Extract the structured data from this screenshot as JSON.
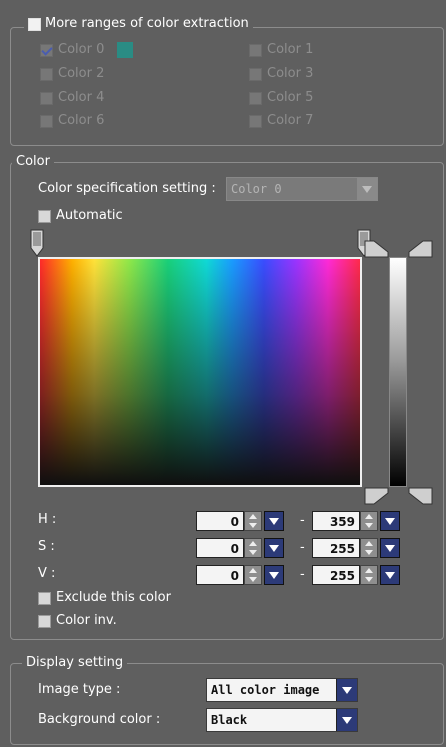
{
  "extraction": {
    "title": "More ranges of color extraction",
    "colors": [
      {
        "label": "Color 0",
        "checked": true,
        "enabled": true
      },
      {
        "label": "Color 1",
        "checked": false,
        "enabled": false
      },
      {
        "label": "Color 2",
        "checked": false,
        "enabled": false
      },
      {
        "label": "Color 3",
        "checked": false,
        "enabled": false
      },
      {
        "label": "Color 4",
        "checked": false,
        "enabled": false
      },
      {
        "label": "Color 5",
        "checked": false,
        "enabled": false
      },
      {
        "label": "Color 6",
        "checked": false,
        "enabled": false
      },
      {
        "label": "Color 7",
        "checked": false,
        "enabled": false
      }
    ],
    "swatch_color": "#2a8c84"
  },
  "color": {
    "title": "Color",
    "spec_label": "Color specification setting :",
    "spec_value": "Color 0",
    "automatic_label": "Automatic",
    "h_label": "H :",
    "s_label": "S :",
    "v_label": "V :",
    "h_min": "0",
    "h_max": "359",
    "s_min": "0",
    "s_max": "255",
    "v_min": "0",
    "v_max": "255",
    "range_separator": "-",
    "exclude_label": "Exclude this color",
    "inv_label": "Color inv."
  },
  "display": {
    "title": "Display setting",
    "image_type_label": "Image type :",
    "image_type_value": "All color image",
    "bg_label": "Background color :",
    "bg_value": "Black"
  }
}
